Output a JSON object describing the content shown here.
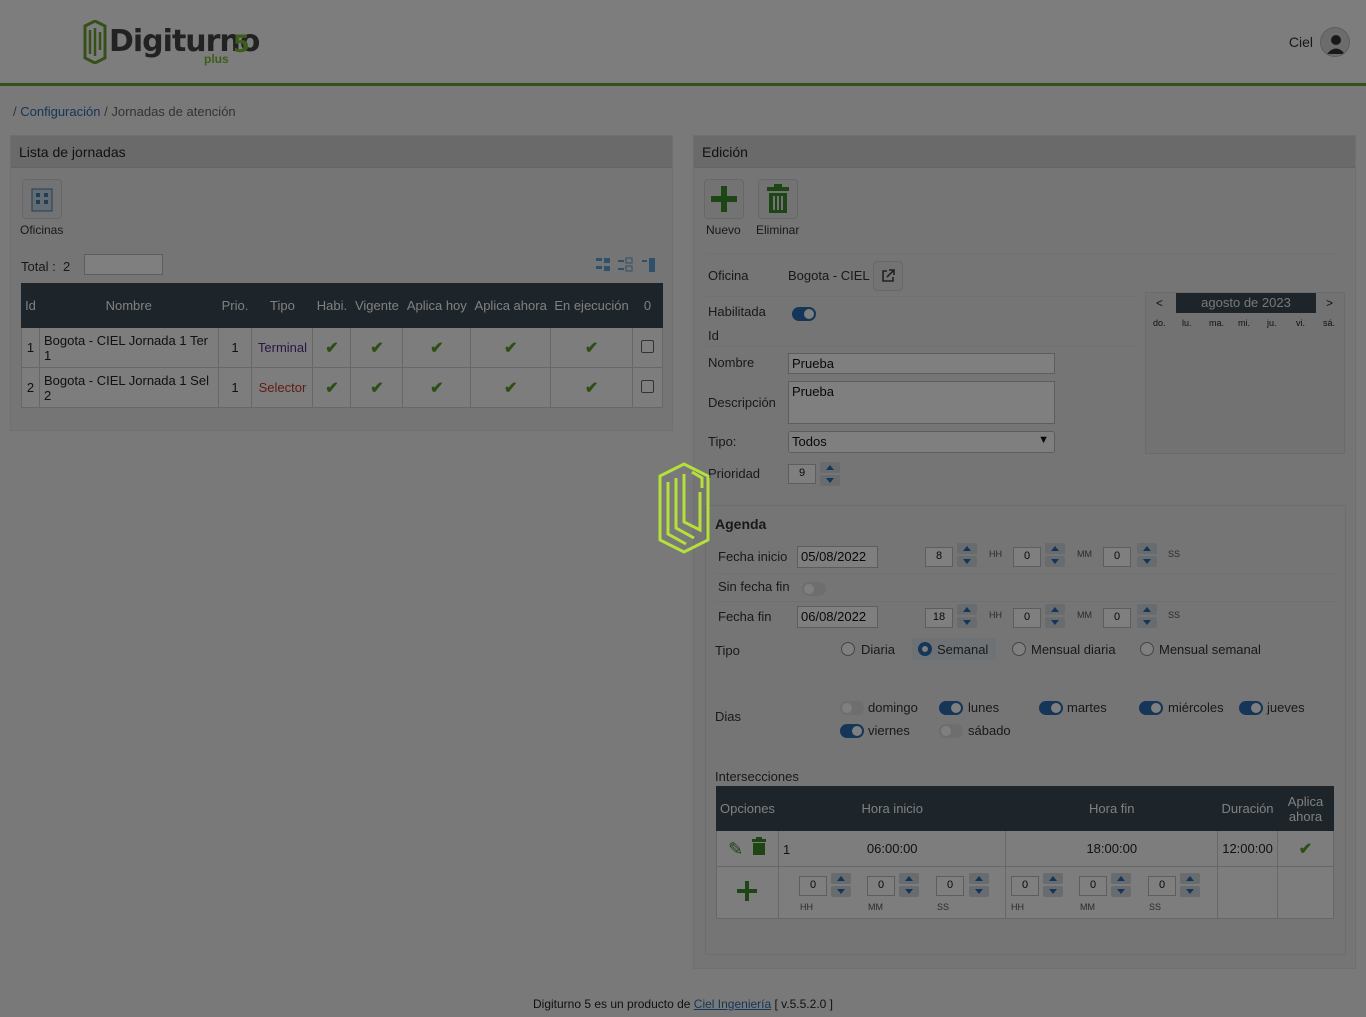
{
  "brand": {
    "name": "Digiturno",
    "version_mark": "5",
    "sub": "plus"
  },
  "user": {
    "name": "Ciel"
  },
  "breadcrumb": {
    "sep1": "/",
    "link": "Configuración",
    "sep2": "/",
    "current": "Jornadas de atención"
  },
  "left_panel": {
    "title": "Lista de jornadas",
    "offices_button": "Oficinas",
    "total_label": "Total :",
    "total_value": "2",
    "columns": [
      "Id",
      "Nombre",
      "Prio.",
      "Tipo",
      "Habi.",
      "Vigente",
      "Aplica hoy",
      "Aplica ahora",
      "En ejecución",
      "0"
    ],
    "rows": [
      {
        "id": "1",
        "nombre": "Bogota - CIEL Jornada 1 Ter 1",
        "prio": "1",
        "tipo": "Terminal",
        "tipo_color": "#5a2b8a"
      },
      {
        "id": "2",
        "nombre": "Bogota - CIEL Jornada 1 Sel 2",
        "prio": "1",
        "tipo": "Selector",
        "tipo_color": "#c0392b"
      }
    ]
  },
  "right_panel": {
    "title": "Edición",
    "new_button": "Nuevo",
    "delete_button": "Eliminar",
    "oficina_label": "Oficina",
    "oficina_value": "Bogota - CIEL",
    "habilitada_label": "Habilitada",
    "habilitada": true,
    "id_label": "Id",
    "nombre_label": "Nombre",
    "nombre_value": "Prueba",
    "descripcion_label": "Descripción",
    "descripcion_value": "Prueba",
    "tipo_label": "Tipo:",
    "tipo_value": "Todos",
    "prioridad_label": "Prioridad",
    "prioridad_value": "9",
    "calendar": {
      "prev": "<",
      "next": ">",
      "title": "agosto de 2023",
      "weekdays": [
        "do.",
        "lu.",
        "ma.",
        "mi.",
        "ju.",
        "vi.",
        "sá."
      ]
    },
    "agenda": {
      "title": "Agenda",
      "fecha_inicio_label": "Fecha inicio",
      "fecha_inicio": "05/08/2022",
      "inicio_hh": "8",
      "inicio_mm": "0",
      "inicio_ss": "0",
      "sin_fecha_fin_label": "Sin fecha fin",
      "fecha_fin_label": "Fecha fin",
      "fecha_fin": "06/08/2022",
      "fin_hh": "18",
      "fin_mm": "0",
      "fin_ss": "0",
      "hh": "HH",
      "mm": "MM",
      "ss": "SS",
      "tipo_label": "Tipo",
      "tipo_options": [
        "Diaria",
        "Semanal",
        "Mensual diaria",
        "Mensual semanal"
      ],
      "tipo_selected": "Semanal",
      "dias_label": "Dias",
      "dias": [
        {
          "name": "domingo",
          "on": false
        },
        {
          "name": "lunes",
          "on": true
        },
        {
          "name": "martes",
          "on": true
        },
        {
          "name": "miércoles",
          "on": true
        },
        {
          "name": "jueves",
          "on": true
        },
        {
          "name": "viernes",
          "on": true
        },
        {
          "name": "sábado",
          "on": false
        }
      ],
      "intersecciones_label": "Intersecciones",
      "int_columns": [
        "Opciones",
        "Hora inicio",
        "Hora fin",
        "Duración",
        "Aplica ahora"
      ],
      "int_row": {
        "n": "1",
        "inicio": "06:00:00",
        "fin": "18:00:00",
        "duracion": "12:00:00"
      },
      "new_row": {
        "hh1": "0",
        "mm1": "0",
        "ss1": "0",
        "hh2": "0",
        "mm2": "0",
        "ss2": "0"
      }
    }
  },
  "footer": {
    "prefix": "Digiturno 5 es un producto de",
    "link": "Ciel Ingeniería",
    "version": "[ v.5.5.2.0 ]"
  },
  "colors": {
    "accent": "#6aa332",
    "header_dark": "#3b4a54",
    "link": "#2b6cb3",
    "loader": "#b5e03a"
  }
}
